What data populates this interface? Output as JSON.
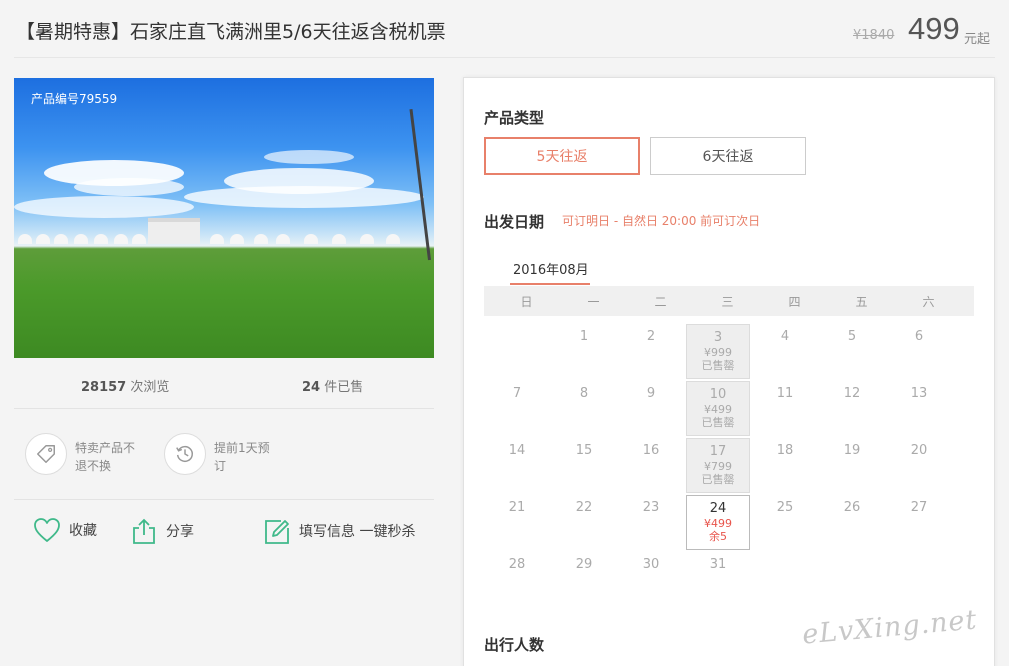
{
  "header": {
    "title": "【暑期特惠】石家庄直飞满洲里5/6天往返含税机票",
    "old_price": "¥1840",
    "price": "499",
    "price_unit": "元起"
  },
  "photo": {
    "product_no": "产品编号79559"
  },
  "stats": {
    "views_num": "28157",
    "views_label": " 次浏览",
    "sold_num": "24",
    "sold_label": " 件已售"
  },
  "features": [
    {
      "icon": "tag-icon",
      "text": "特卖产品不退不换"
    },
    {
      "icon": "history-clock-icon",
      "text": "提前1天预订"
    }
  ],
  "actions": {
    "favorite": "收藏",
    "share": "分享",
    "fill_info": "填写信息 一键秒杀"
  },
  "booking": {
    "type_title": "产品类型",
    "types": [
      "5天往返",
      "6天往返"
    ],
    "selected_type": "5天往返",
    "date_title": "出发日期",
    "date_note": "可订明日 - 自然日 20:00 前可订次日",
    "month": "2016年08月",
    "weekdays": [
      "日",
      "一",
      "二",
      "三",
      "四",
      "五",
      "六"
    ],
    "days": [
      {
        "n": "1"
      },
      {
        "n": "2"
      },
      {
        "n": "3",
        "price": "¥999",
        "status": "已售罄",
        "state": "sold"
      },
      {
        "n": "4"
      },
      {
        "n": "5"
      },
      {
        "n": "6"
      },
      {
        "n": "7"
      },
      {
        "n": "8"
      },
      {
        "n": "9"
      },
      {
        "n": "10",
        "price": "¥499",
        "status": "已售罄",
        "state": "sold"
      },
      {
        "n": "11"
      },
      {
        "n": "12"
      },
      {
        "n": "13"
      },
      {
        "n": "14"
      },
      {
        "n": "15"
      },
      {
        "n": "16"
      },
      {
        "n": "17",
        "price": "¥799",
        "status": "已售罄",
        "state": "sold"
      },
      {
        "n": "18"
      },
      {
        "n": "19"
      },
      {
        "n": "20"
      },
      {
        "n": "21"
      },
      {
        "n": "22"
      },
      {
        "n": "23"
      },
      {
        "n": "24",
        "price": "¥499",
        "status": "余5",
        "state": "available"
      },
      {
        "n": "25"
      },
      {
        "n": "26"
      },
      {
        "n": "27"
      },
      {
        "n": "28"
      },
      {
        "n": "29"
      },
      {
        "n": "30"
      },
      {
        "n": "31"
      }
    ],
    "first_weekday_offset": 1,
    "travelers_title": "出行人数"
  },
  "watermark": "eLvXing.net",
  "colors": {
    "accent": "#e8806a",
    "price_red": "#e8544b",
    "icon_green": "#3fb98a"
  }
}
